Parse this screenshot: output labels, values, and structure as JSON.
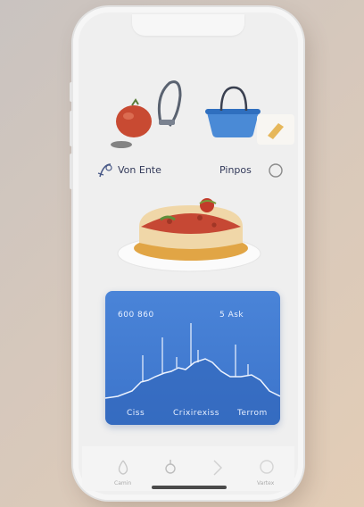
{
  "header": {
    "left_label": "Von Ente",
    "right_label": "Pinpos"
  },
  "chart_card": {
    "top_left": "600 860",
    "top_right": "5 Ask",
    "bottom_left": "Ciss",
    "bottom_center": "Crixirexiss",
    "bottom_right": "Terrom",
    "accent": "#3c74cb"
  },
  "tabbar": {
    "left_label": "Camin",
    "right_label": "Vartex"
  },
  "icons": [
    "stopwatch-icon",
    "pear-icon",
    "chevron-icon",
    "lemon-icon",
    "tomato-icon",
    "bucket-icon",
    "cheese-icon",
    "search-circle-icon"
  ]
}
